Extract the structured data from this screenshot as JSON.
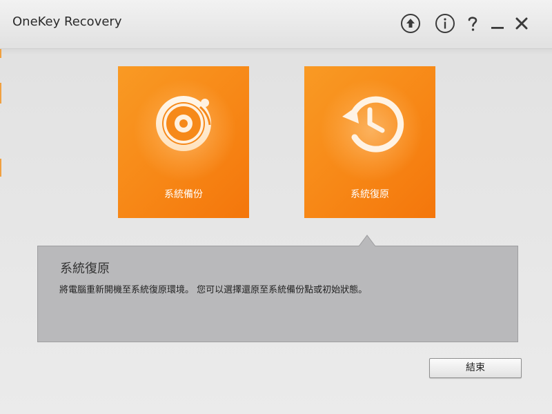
{
  "window": {
    "title": "OneKey Recovery"
  },
  "titlebar_icons": [
    "upload-icon",
    "info-icon",
    "help-icon",
    "minimize-icon",
    "close-icon"
  ],
  "colors": {
    "tile_orange": "#f78716",
    "panel_gray": "#b9b9bb"
  },
  "tiles": [
    {
      "label": "系統備份",
      "icon": "backup-disc-icon"
    },
    {
      "label": "系統復原",
      "icon": "restore-clock-icon"
    }
  ],
  "description": {
    "title": "系統復原",
    "body": "將電腦重新開機至系統復原環境。 您可以選擇還原至系統備份點或初始狀態。"
  },
  "footer": {
    "exit_label": "結束"
  }
}
